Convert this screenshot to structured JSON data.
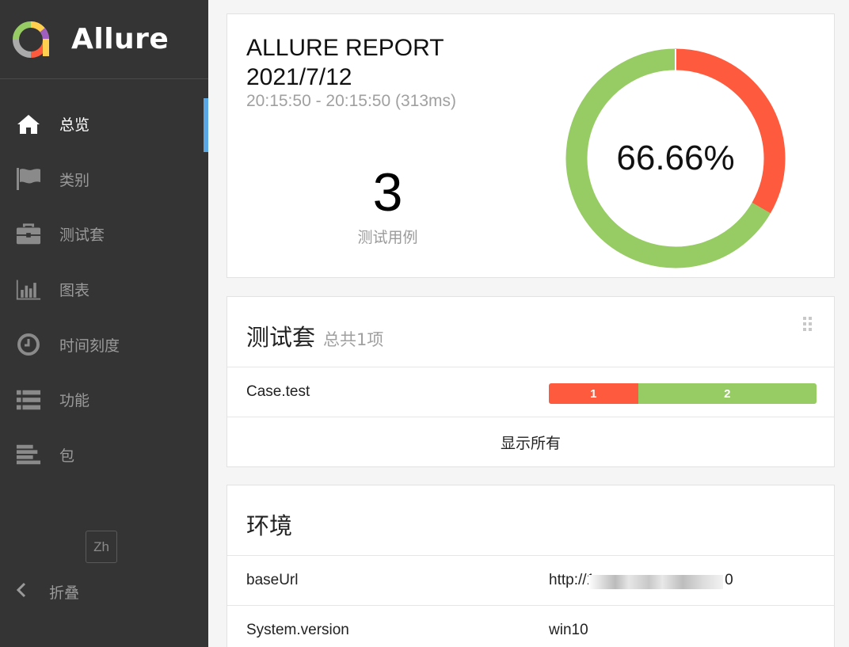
{
  "brand": {
    "title": "Allure"
  },
  "nav": [
    {
      "label": "总览",
      "icon": "home-icon",
      "active": true
    },
    {
      "label": "类别",
      "icon": "flag-icon",
      "active": false
    },
    {
      "label": "测试套",
      "icon": "briefcase-icon",
      "active": false
    },
    {
      "label": "图表",
      "icon": "bar-chart-icon",
      "active": false
    },
    {
      "label": "时间刻度",
      "icon": "clock-icon",
      "active": false
    },
    {
      "label": "功能",
      "icon": "list-icon",
      "active": false
    },
    {
      "label": "包",
      "icon": "align-left-icon",
      "active": false
    }
  ],
  "lang": "Zh",
  "collapse_label": "折叠",
  "summary": {
    "title_line1": "ALLURE REPORT",
    "title_line2": "2021/7/12",
    "time": "20:15:50 - 20:15:50 (313ms)",
    "count": "3",
    "count_label": "测试用例",
    "percent": "66.66%",
    "passed_fraction": 0.6666,
    "colors": {
      "passed": "#97cc64",
      "failed": "#fd5a3e"
    }
  },
  "suites": {
    "title": "测试套",
    "subtitle": "总共1项",
    "rows": [
      {
        "name": "Case.test",
        "failed": "1",
        "passed": "2",
        "failed_fraction": 0.3333
      }
    ],
    "show_all": "显示所有"
  },
  "environment": {
    "title": "环境",
    "rows": [
      {
        "key": "baseUrl",
        "value": "http://1",
        "value_tail": "0"
      },
      {
        "key": "System.version",
        "value": "win10"
      }
    ]
  }
}
